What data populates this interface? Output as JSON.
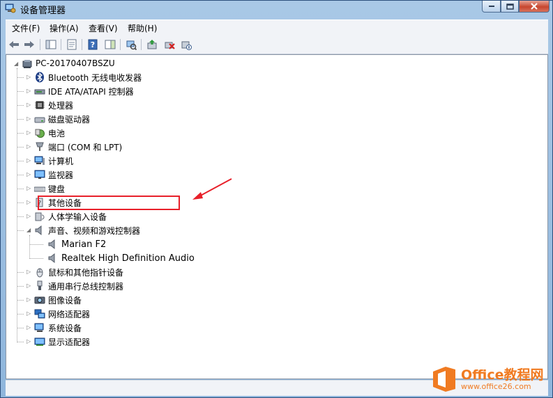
{
  "window": {
    "title": "设备管理器"
  },
  "menu": [
    "文件(F)",
    "操作(A)",
    "查看(V)",
    "帮助(H)"
  ],
  "tree": {
    "root": "PC-20170407BSZU",
    "categories": [
      {
        "label": "Bluetooth 无线电收发器",
        "icon": "bluetooth-icon"
      },
      {
        "label": "IDE ATA/ATAPI 控制器",
        "icon": "ide-controller-icon"
      },
      {
        "label": "处理器",
        "icon": "processor-icon"
      },
      {
        "label": "磁盘驱动器",
        "icon": "disk-drive-icon"
      },
      {
        "label": "电池",
        "icon": "battery-icon"
      },
      {
        "label": "端口 (COM 和 LPT)",
        "icon": "port-icon"
      },
      {
        "label": "计算机",
        "icon": "computer-icon"
      },
      {
        "label": "监视器",
        "icon": "monitor-icon"
      },
      {
        "label": "键盘",
        "icon": "keyboard-icon"
      },
      {
        "label": "其他设备",
        "icon": "other-device-icon"
      },
      {
        "label": "人体学输入设备",
        "icon": "hid-icon"
      },
      {
        "label": "声音、视频和游戏控制器",
        "icon": "speaker-icon",
        "expanded": true,
        "children": [
          "Marian F2",
          "Realtek High Definition Audio"
        ]
      },
      {
        "label": "鼠标和其他指针设备",
        "icon": "mouse-icon"
      },
      {
        "label": "通用串行总线控制器",
        "icon": "usb-icon"
      },
      {
        "label": "图像设备",
        "icon": "imaging-icon"
      },
      {
        "label": "网络适配器",
        "icon": "network-icon"
      },
      {
        "label": "系统设备",
        "icon": "system-icon"
      },
      {
        "label": "显示适配器",
        "icon": "display-adapter-icon"
      }
    ]
  },
  "watermark": {
    "title": "Office教程网",
    "url": "www.office26.com"
  }
}
